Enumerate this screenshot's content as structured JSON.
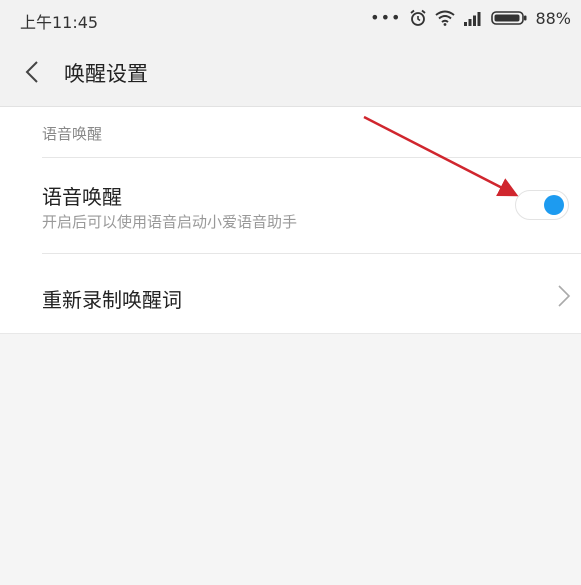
{
  "status_bar": {
    "time": "上午11:45",
    "dots": "•••",
    "battery_text": "88%",
    "icons": [
      "alarm-icon",
      "wifi-icon",
      "signal-icon",
      "battery-icon"
    ]
  },
  "header": {
    "title": "唤醒设置",
    "back_icon": "chevron-left-icon"
  },
  "section": {
    "label": "语音唤醒",
    "items": [
      {
        "title": "语音唤醒",
        "subtitle": "开启后可以使用语音启动小爱语音助手",
        "toggle_on": true
      },
      {
        "title": "重新录制唤醒词"
      }
    ]
  },
  "colors": {
    "toggle_accent": "#1d9bf0",
    "annotation_arrow": "#d0262e"
  }
}
